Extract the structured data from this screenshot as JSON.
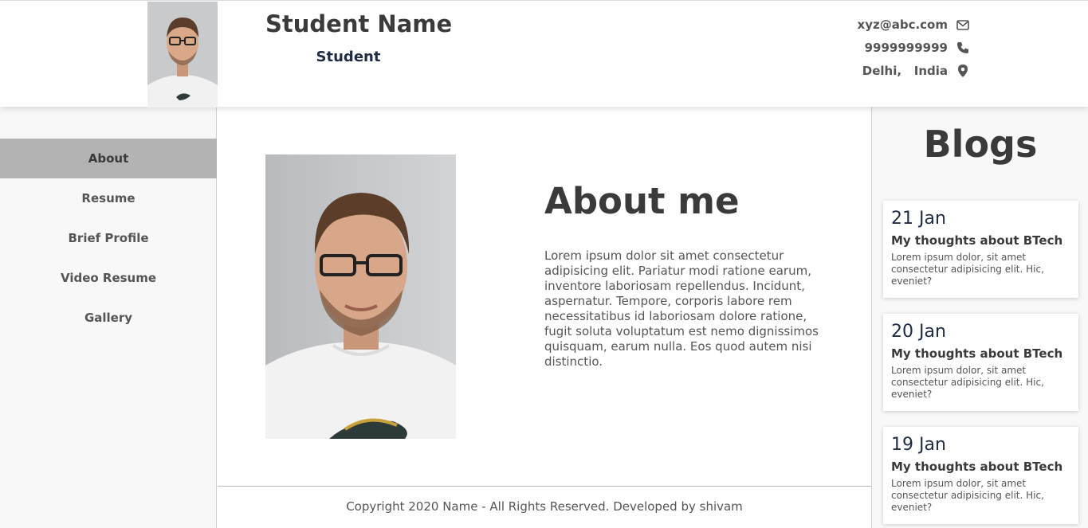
{
  "header": {
    "name": "Student Name",
    "role": "Student",
    "contacts": [
      {
        "text": "xyz@abc.com",
        "icon": "envelope-icon"
      },
      {
        "text": "9999999999",
        "icon": "phone-icon"
      },
      {
        "text": "Delhi,   India",
        "icon": "map-marker-icon"
      }
    ]
  },
  "sidebar": {
    "items": [
      {
        "label": "About",
        "active": true
      },
      {
        "label": "Resume"
      },
      {
        "label": "Brief Profile"
      },
      {
        "label": "Video Resume"
      },
      {
        "label": "Gallery"
      }
    ]
  },
  "about": {
    "title": "About me",
    "text": "Lorem ipsum dolor sit amet consectetur adipisicing elit. Pariatur modi ratione earum, inventore laboriosam repellendus. Incidunt, aspernatur. Tempore, corporis labore rem necessitatibus id laboriosam dolore ratione, fugit soluta voluptatum est nemo dignissimos quisquam, earum nulla. Eos quod autem nisi distinctio."
  },
  "footer": {
    "text": "Copyright 2020 Name - All Rights Reserved. Developed by shivam"
  },
  "blogs": {
    "title": "Blogs",
    "posts": [
      {
        "date": "21 Jan",
        "heading": "My thoughts about BTech",
        "text": "Lorem ipsum dolor, sit amet consectetur adipisicing elit. Hic, eveniet?"
      },
      {
        "date": "20 Jan",
        "heading": "My thoughts about BTech",
        "text": "Lorem ipsum dolor, sit amet consectetur adipisicing elit. Hic, eveniet?"
      },
      {
        "date": "19 Jan",
        "heading": "My thoughts about BTech",
        "text": "Lorem ipsum dolor, sit amet consectetur adipisicing elit. Hic, eveniet?"
      }
    ]
  },
  "colors": {
    "active_nav": "#b3b3b3",
    "accent_navy": "#1f2a44",
    "text_dark": "#3a3a3a"
  }
}
